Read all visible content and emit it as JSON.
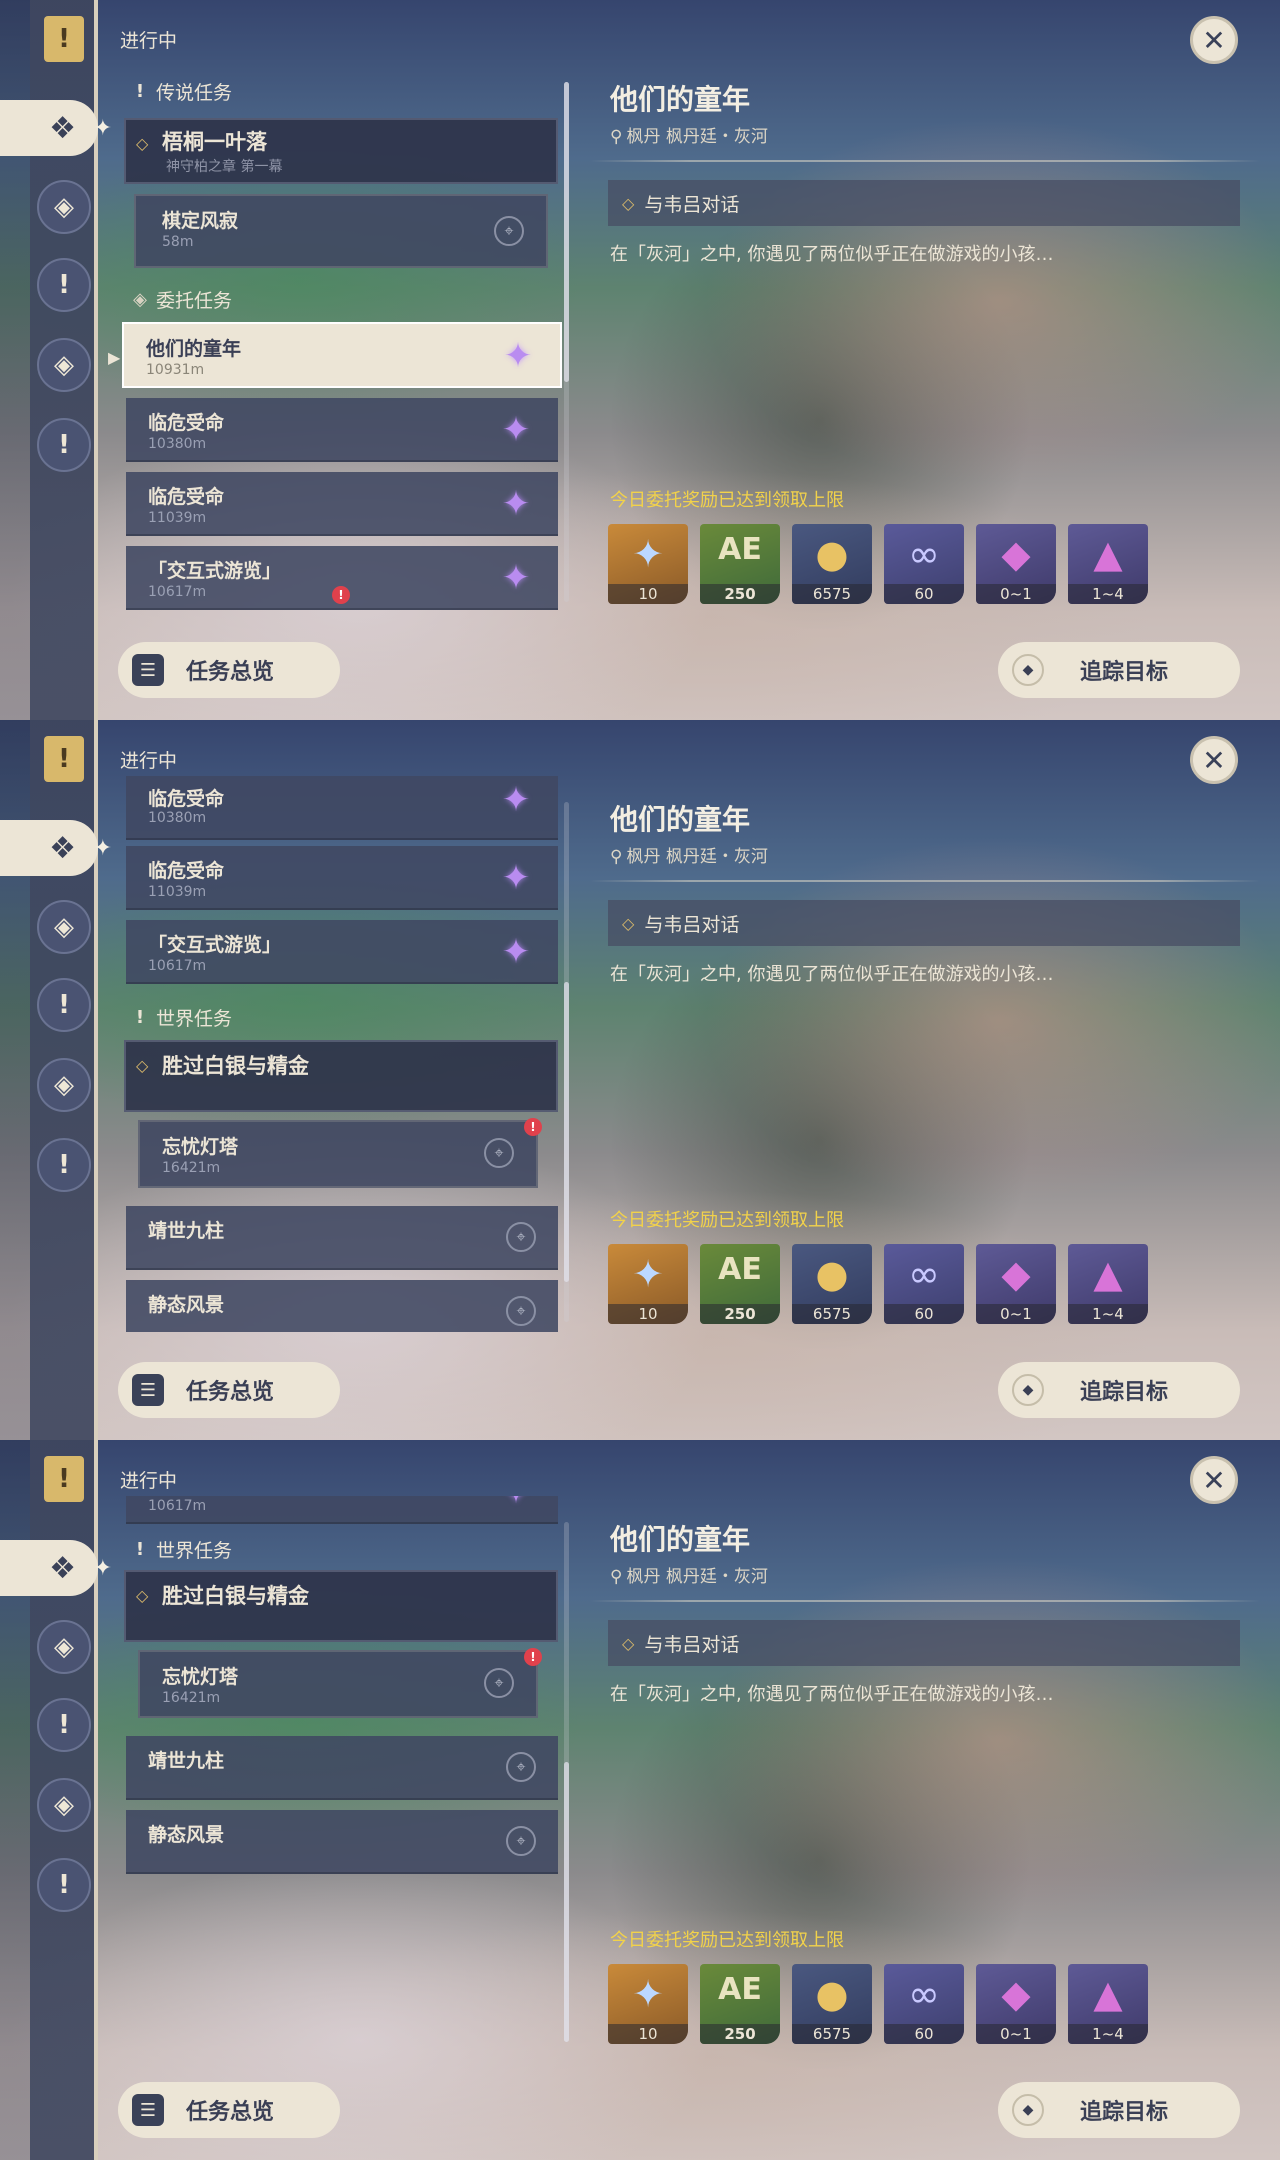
{
  "status_label": "进行中",
  "overview_button": "任务总览",
  "track_button": "追踪目标",
  "detail": {
    "title": "他们的童年",
    "location": "枫丹 枫丹廷・灰河",
    "objective": "与韦吕对话",
    "description": "在「灰河」之中, 你遇见了两位似乎正在做游戏的小孩…",
    "reward_note": "今日委托奖励已达到领取上限",
    "rewards": [
      {
        "icon": "primogem-icon",
        "count": "10"
      },
      {
        "icon": "adventure-exp-icon",
        "count": "250"
      },
      {
        "icon": "mora-icon",
        "count": "6575"
      },
      {
        "icon": "friendship-exp-icon",
        "count": "60"
      },
      {
        "icon": "crystal-chunk-icon",
        "count": "0~1"
      },
      {
        "icon": "crystal-cluster-icon",
        "count": "1~4"
      }
    ]
  },
  "sections": {
    "legend": "传说任务",
    "commission": "委托任务",
    "world": "世界任务"
  },
  "quests": {
    "wutong": {
      "title": "梧桐一叶落",
      "subtitle": "神守柏之章 第一幕"
    },
    "qiding": {
      "title": "棋定风寂",
      "distance": "58m"
    },
    "childhood": {
      "title": "他们的童年",
      "distance": "10931m"
    },
    "peril1": {
      "title": "临危受命",
      "distance": "10380m"
    },
    "peril2": {
      "title": "临危受命",
      "distance": "11039m"
    },
    "tour": {
      "title": "「交互式游览」",
      "distance": "10617m"
    },
    "silver": {
      "title": "胜过白银与精金"
    },
    "lighthouse": {
      "title": "忘忧灯塔",
      "distance": "16421m"
    },
    "jingshi": {
      "title": "靖世九柱"
    },
    "scenery": {
      "title": "静态风景"
    }
  },
  "icons": {
    "rail": [
      "bookmark-icon",
      "quest-type-icon",
      "legend-quest-icon",
      "world-quest-icon",
      "commission-quest-icon",
      "exclamation-icon"
    ]
  },
  "colors": {
    "accent_gold": "#d8b86b",
    "reward_note": "#f2d24a",
    "commission_star": "#b98cf0",
    "alert": "#e0414c"
  },
  "scroll_position": [
    0.0,
    0.5,
    0.95
  ]
}
